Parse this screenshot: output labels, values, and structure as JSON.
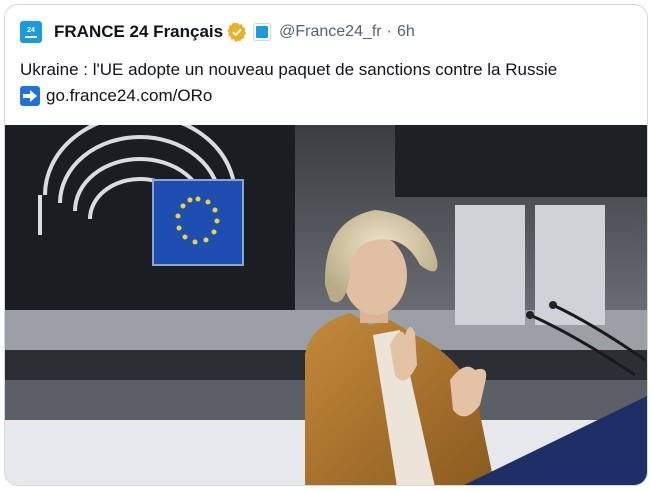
{
  "account": {
    "avatar_badge": "24",
    "avatar_caption": "FRANCE",
    "name": "FRANCE 24 Français",
    "handle": "@France24_fr",
    "separator": "·",
    "time": "6h"
  },
  "tweet": {
    "text": "Ukraine : l'UE adopte un nouveau paquet de sanctions contre la Russie",
    "link_icon": "right-arrow-icon",
    "link": "go.france24.com/ORo"
  },
  "colors": {
    "verified": "#e8b12b",
    "brand": "#1b9ae0",
    "text": "#0f1419",
    "muted": "#536471"
  },
  "photo": {
    "description_icon": "photo"
  }
}
